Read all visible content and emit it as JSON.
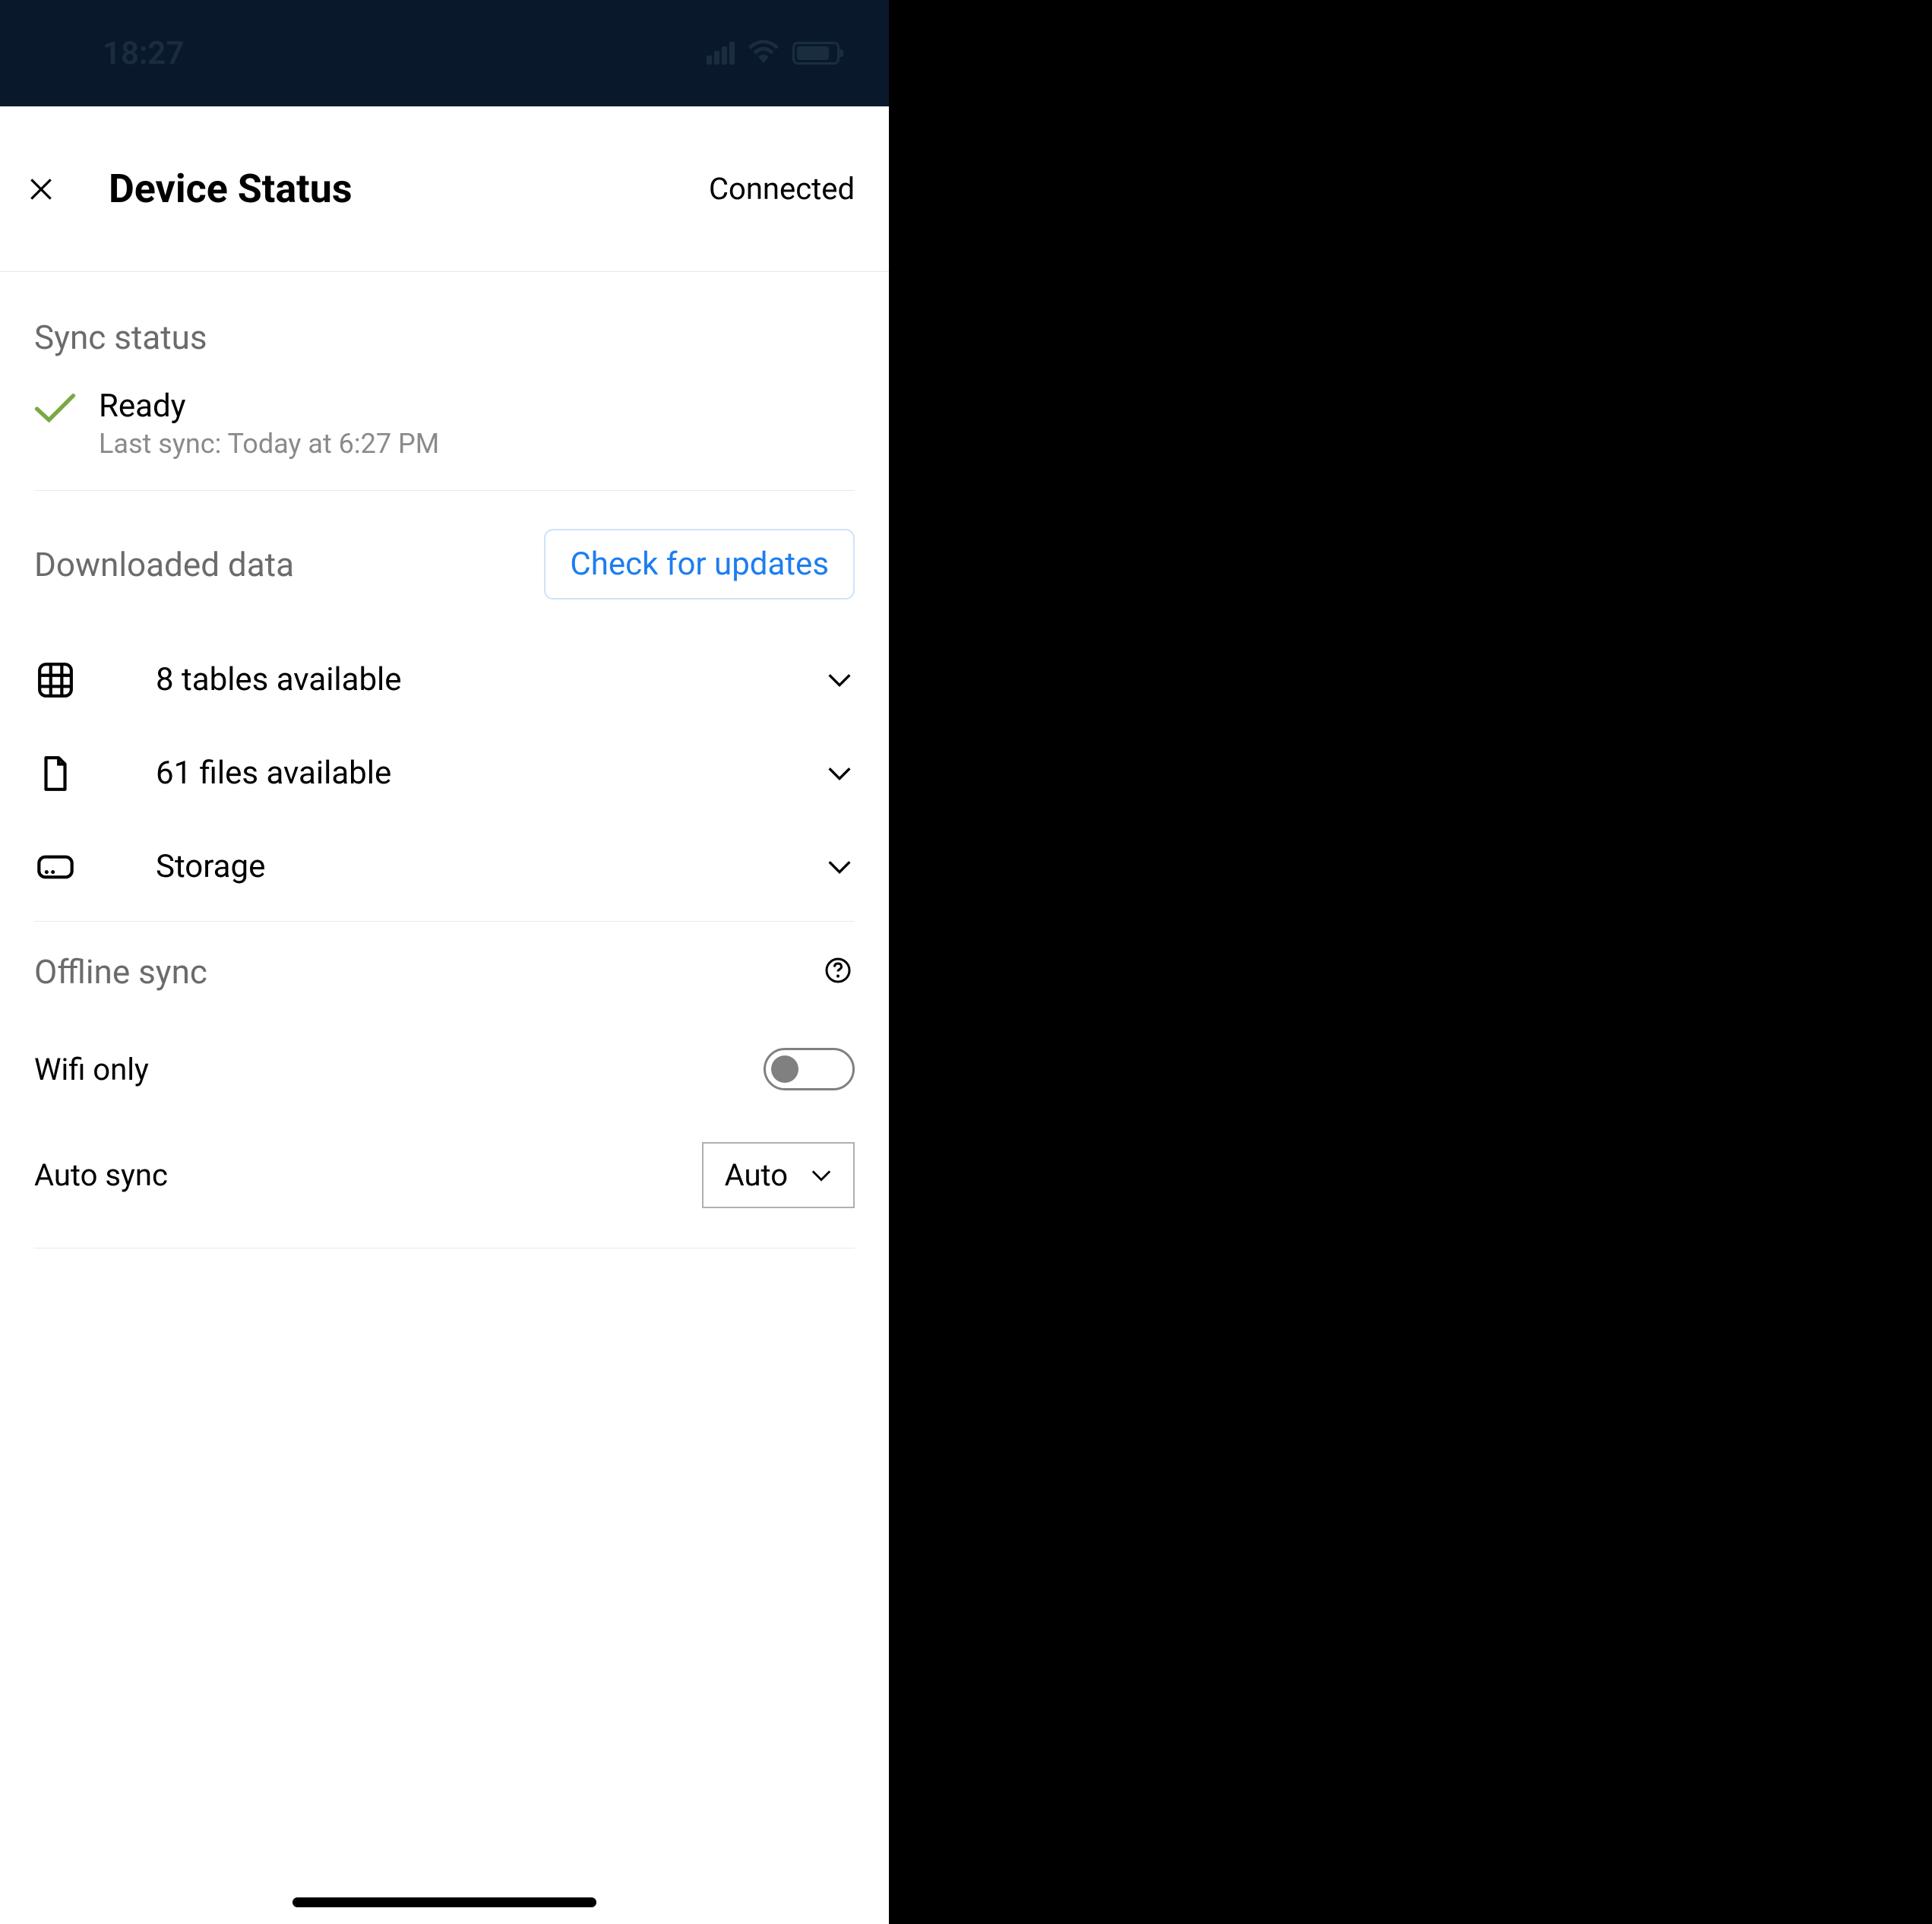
{
  "status_bar": {
    "time": "18:27"
  },
  "header": {
    "title": "Device Status",
    "connection": "Connected"
  },
  "sections": {
    "sync_status": {
      "header": "Sync status",
      "state": "Ready",
      "last_sync": "Last sync: Today at 6:27 PM"
    },
    "downloaded_data": {
      "header": "Downloaded data",
      "check_updates_label": "Check for updates",
      "rows": {
        "tables": "8 tables available",
        "files": "61 files available",
        "storage": "Storage"
      }
    },
    "offline_sync": {
      "header": "Offline sync",
      "wifi_only_label": "Wifi only",
      "auto_sync_label": "Auto sync",
      "auto_sync_value": "Auto"
    }
  }
}
